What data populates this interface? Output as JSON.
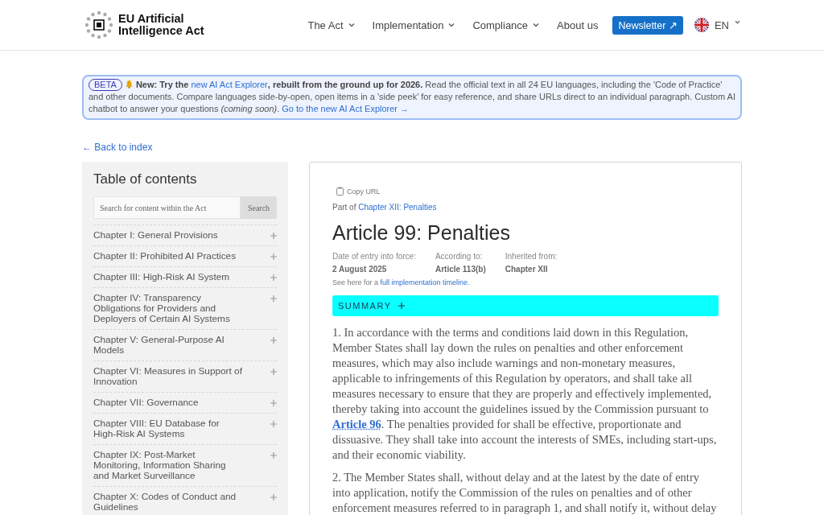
{
  "header": {
    "logo_text": "EU Artificial Intelligence Act",
    "nav": [
      {
        "label": "The Act",
        "dropdown": true
      },
      {
        "label": "Implementation",
        "dropdown": true
      },
      {
        "label": "Compliance",
        "dropdown": true
      },
      {
        "label": "About us",
        "dropdown": false
      }
    ],
    "newsletter_button": "Newsletter ↗",
    "language": "EN"
  },
  "banner": {
    "badge": "BETA",
    "parts": [
      {
        "kind": "text",
        "text": "**New: Try the** "
      },
      {
        "kind": "link",
        "text": "new AI Act Explorer"
      },
      {
        "kind": "text",
        "text": "**, rebuilt from the ground up for 2026.** Read the official text in all 24 EU languages, including the 'Code of Practice' and other documents. Compare languages side-by-open, open items in a 'side peek' for easy reference, and share URLs direct to an individual paragraph. Custom AI chatbot to answer your questions *(coming soon)*. "
      },
      {
        "kind": "link",
        "text": "Go to the new AI Act Explorer →"
      }
    ]
  },
  "back_link": "← Back to index",
  "toc": {
    "title": "Table of contents",
    "search": {
      "placeholder": "Search for content within the Act",
      "button": "Search"
    },
    "items": [
      {
        "label": "Chapter I: General Provisions",
        "expanded": false
      },
      {
        "label": "Chapter II: Prohibited AI Practices",
        "expanded": false
      },
      {
        "label": "Chapter III: High-Risk AI System",
        "expanded": false
      },
      {
        "label": "Chapter IV: Transparency Obligations for Providers and Deployers of Certain AI Systems",
        "expanded": false
      },
      {
        "label": "Chapter V: General-Purpose AI Models",
        "expanded": false
      },
      {
        "label": "Chapter VI: Measures in Support of Innovation",
        "expanded": false
      },
      {
        "label": "Chapter VII: Governance",
        "expanded": false
      },
      {
        "label": "Chapter VIII: EU Database for High-Risk AI Systems",
        "expanded": false
      },
      {
        "label": "Chapter IX: Post-Market Monitoring, Information Sharing and Market Surveillance",
        "expanded": false
      },
      {
        "label": "Chapter X: Codes of Conduct and Guidelines",
        "expanded": false
      }
    ]
  },
  "article": {
    "copy_url": "Copy URL",
    "part_of_prefix": "Part of",
    "part_of_link": "Chapter XII: Penalties",
    "title": "Article 99: Penalties",
    "meta": [
      {
        "label": "Date of entry into force:",
        "value": "2 August 2025"
      },
      {
        "label": "According to:",
        "value": "Article 113(b)"
      },
      {
        "label": "Inherited from:",
        "value": "Chapter XII"
      }
    ],
    "timeline_note": [
      {
        "kind": "text",
        "text": "See here for a "
      },
      {
        "kind": "link",
        "text": "full implementation timeline"
      },
      {
        "kind": "text",
        "text": "."
      }
    ],
    "summary": {
      "label": "SUMMARY",
      "expanded": false
    },
    "paragraphs": [
      [
        {
          "kind": "text",
          "text": "1. In accordance with the terms and conditions laid down in this Regulation, Member States shall lay down the rules on penalties and other enforcement measures, which may also include warnings and non-monetary measures, applicable to infringements of this Regulation by operators, and shall take all measures necessary to ensure that they are properly and effectively implemented, thereby taking into account the guidelines issued by the Commission pursuant to "
        },
        {
          "kind": "link",
          "text": "Article 96"
        },
        {
          "kind": "text",
          "text": ". The penalties provided for shall be effective, proportionate and dissuasive. They shall take into account the interests of SMEs, including start-ups, and their economic viability."
        }
      ],
      [
        {
          "kind": "text",
          "text": "2. The Member States shall, without delay and at the latest by the date of entry into application, notify the Commission of the rules on penalties and of other enforcement measures referred to in paragraph 1, and shall notify it, without delay"
        }
      ]
    ]
  }
}
